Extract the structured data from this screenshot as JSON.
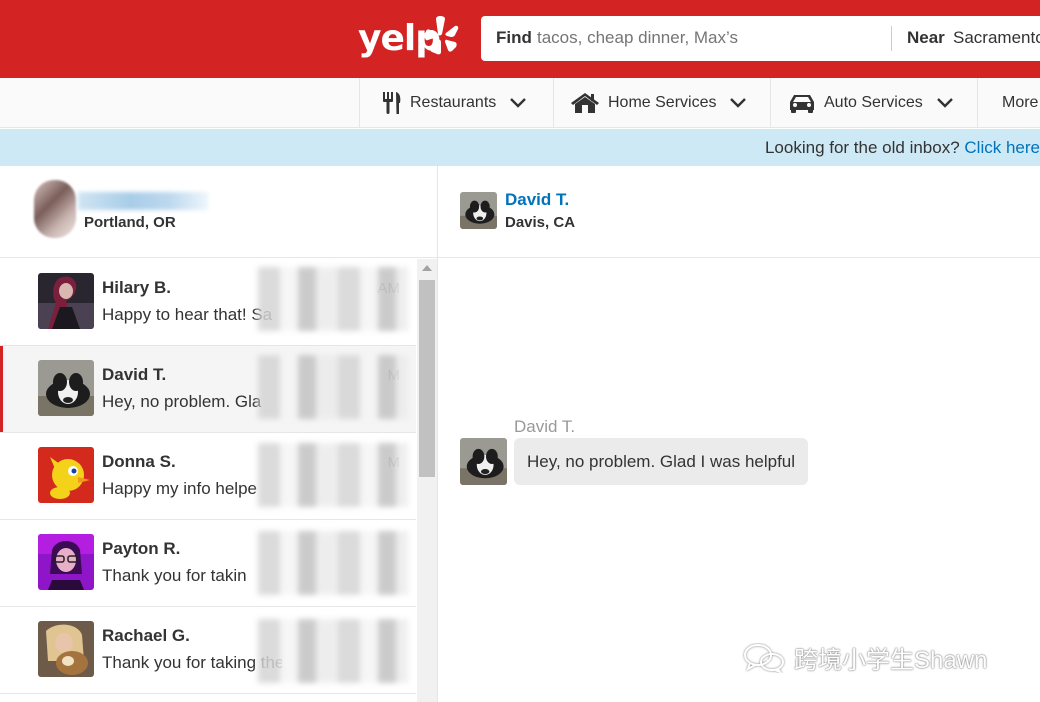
{
  "header": {
    "logo_text": "yelp",
    "search": {
      "find_label": "Find",
      "find_placeholder": "tacos, cheap dinner, Max’s",
      "near_label": "Near",
      "near_value": "Sacramento"
    }
  },
  "categories": [
    {
      "label": "Restaurants",
      "icon": "fork-knife-icon"
    },
    {
      "label": "Home Services",
      "icon": "house-icon"
    },
    {
      "label": "Auto Services",
      "icon": "car-icon"
    },
    {
      "label": "More",
      "icon": ""
    }
  ],
  "banner": {
    "text": "Looking for the old inbox?",
    "link": "Click here"
  },
  "current_user": {
    "location": "Portland, OR"
  },
  "conversations": [
    {
      "name": "Hilary B.",
      "snippet": "Happy to hear that! Sa",
      "time": "AM",
      "active": false
    },
    {
      "name": "David T.",
      "snippet": "Hey, no problem. Gla",
      "time": "M",
      "active": true
    },
    {
      "name": "Donna S.",
      "snippet": "Happy my info helpe",
      "time": "M",
      "active": false
    },
    {
      "name": "Payton R.",
      "snippet": "Thank you for takin",
      "time": "",
      "active": false
    },
    {
      "name": "Rachael G.",
      "snippet": "Thank you for taking the",
      "time": "",
      "active": false
    }
  ],
  "chat": {
    "name": "David T.",
    "location": "Davis, CA",
    "messages": [
      {
        "sender": "David T.",
        "text": "Hey, no problem. Glad I was helpful"
      }
    ]
  },
  "watermark": {
    "text": "跨境小学生Shawn"
  },
  "colors": {
    "brand_red": "#d32323",
    "link_blue": "#0073bb",
    "banner_bg": "#cde9f6"
  }
}
